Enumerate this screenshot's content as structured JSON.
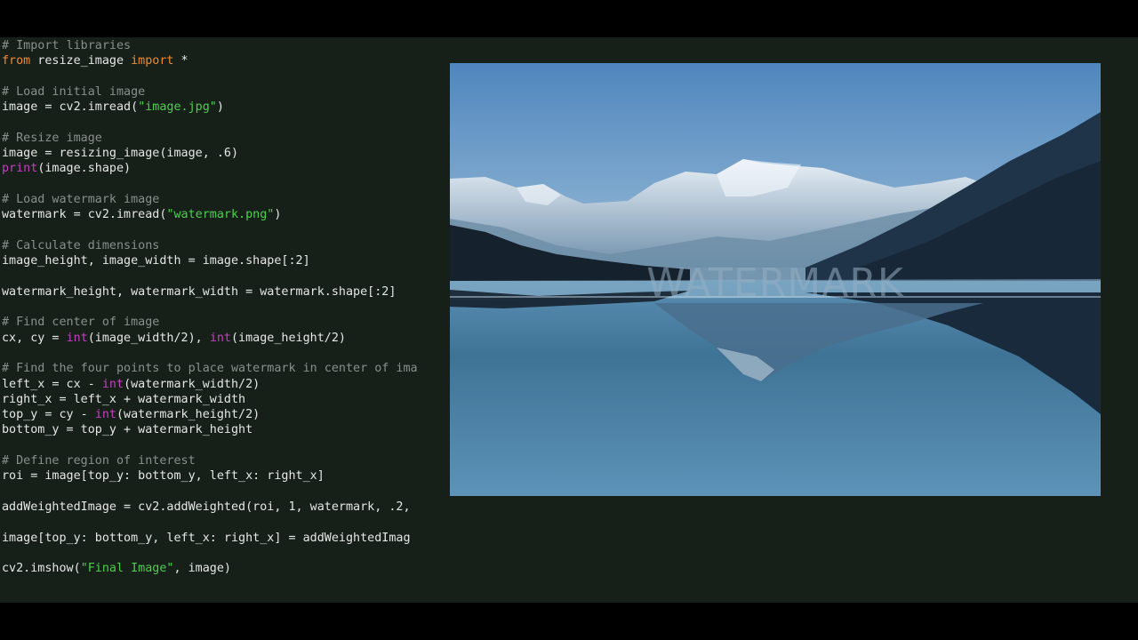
{
  "code_lines": [
    [
      [
        "com",
        "# Import libraries"
      ]
    ],
    [
      [
        "kw",
        "from"
      ],
      [
        "txt",
        " resize_image "
      ],
      [
        "kw",
        "import"
      ],
      [
        "txt",
        " *"
      ]
    ],
    [],
    [
      [
        "com",
        "# Load initial image"
      ]
    ],
    [
      [
        "txt",
        "image = cv2.imread("
      ],
      [
        "str",
        "\"image.jpg\""
      ],
      [
        "txt",
        ")"
      ]
    ],
    [],
    [
      [
        "com",
        "# Resize image"
      ]
    ],
    [
      [
        "txt",
        "image = resizing_image(image, .6)"
      ]
    ],
    [
      [
        "bi",
        "print"
      ],
      [
        "txt",
        "(image.shape)"
      ]
    ],
    [],
    [
      [
        "com",
        "# Load watermark image"
      ]
    ],
    [
      [
        "txt",
        "watermark = cv2.imread("
      ],
      [
        "str",
        "\"watermark.png\""
      ],
      [
        "txt",
        ")"
      ]
    ],
    [],
    [
      [
        "com",
        "# Calculate dimensions"
      ]
    ],
    [
      [
        "txt",
        "image_height, image_width = image.shape[:2]"
      ]
    ],
    [],
    [
      [
        "txt",
        "watermark_height, watermark_width = watermark.shape[:2]"
      ]
    ],
    [],
    [
      [
        "com",
        "# Find center of image"
      ]
    ],
    [
      [
        "txt",
        "cx, cy = "
      ],
      [
        "bi",
        "int"
      ],
      [
        "txt",
        "(image_width/2), "
      ],
      [
        "bi",
        "int"
      ],
      [
        "txt",
        "(image_height/2)"
      ]
    ],
    [],
    [
      [
        "com",
        "# Find the four points to place watermark in center of ima"
      ]
    ],
    [
      [
        "txt",
        "left_x = cx - "
      ],
      [
        "bi",
        "int"
      ],
      [
        "txt",
        "(watermark_width/2)"
      ]
    ],
    [
      [
        "txt",
        "right_x = left_x + watermark_width"
      ]
    ],
    [
      [
        "txt",
        "top_y = cy - "
      ],
      [
        "bi",
        "int"
      ],
      [
        "txt",
        "(watermark_height/2)"
      ]
    ],
    [
      [
        "txt",
        "bottom_y = top_y + watermark_height"
      ]
    ],
    [],
    [
      [
        "com",
        "# Define region of interest"
      ]
    ],
    [
      [
        "txt",
        "roi = image[top_y: bottom_y, left_x: right_x]"
      ]
    ],
    [],
    [
      [
        "txt",
        "addWeightedImage = cv2.addWeighted(roi, 1, watermark, .2,"
      ]
    ],
    [],
    [
      [
        "txt",
        "image[top_y: bottom_y, left_x: right_x] = addWeightedImag"
      ]
    ],
    [],
    [
      [
        "txt",
        "cv2.imshow("
      ],
      [
        "str",
        "\"Final Image\""
      ],
      [
        "txt",
        ", image)"
      ]
    ]
  ],
  "preview": {
    "watermark_text": "WATERMARK",
    "colors": {
      "sky_top": "#4f86bd",
      "sky_bottom": "#8fb4d2",
      "water_top": "#2c5a78",
      "water_bottom": "#1a3a55"
    }
  },
  "colors": {
    "editor_bg": "#162019",
    "comment": "#8a8f8c",
    "keyword": "#f08a2e",
    "string": "#4ccf4c",
    "builtin": "#c23fc0",
    "text": "#e6e6e6"
  }
}
